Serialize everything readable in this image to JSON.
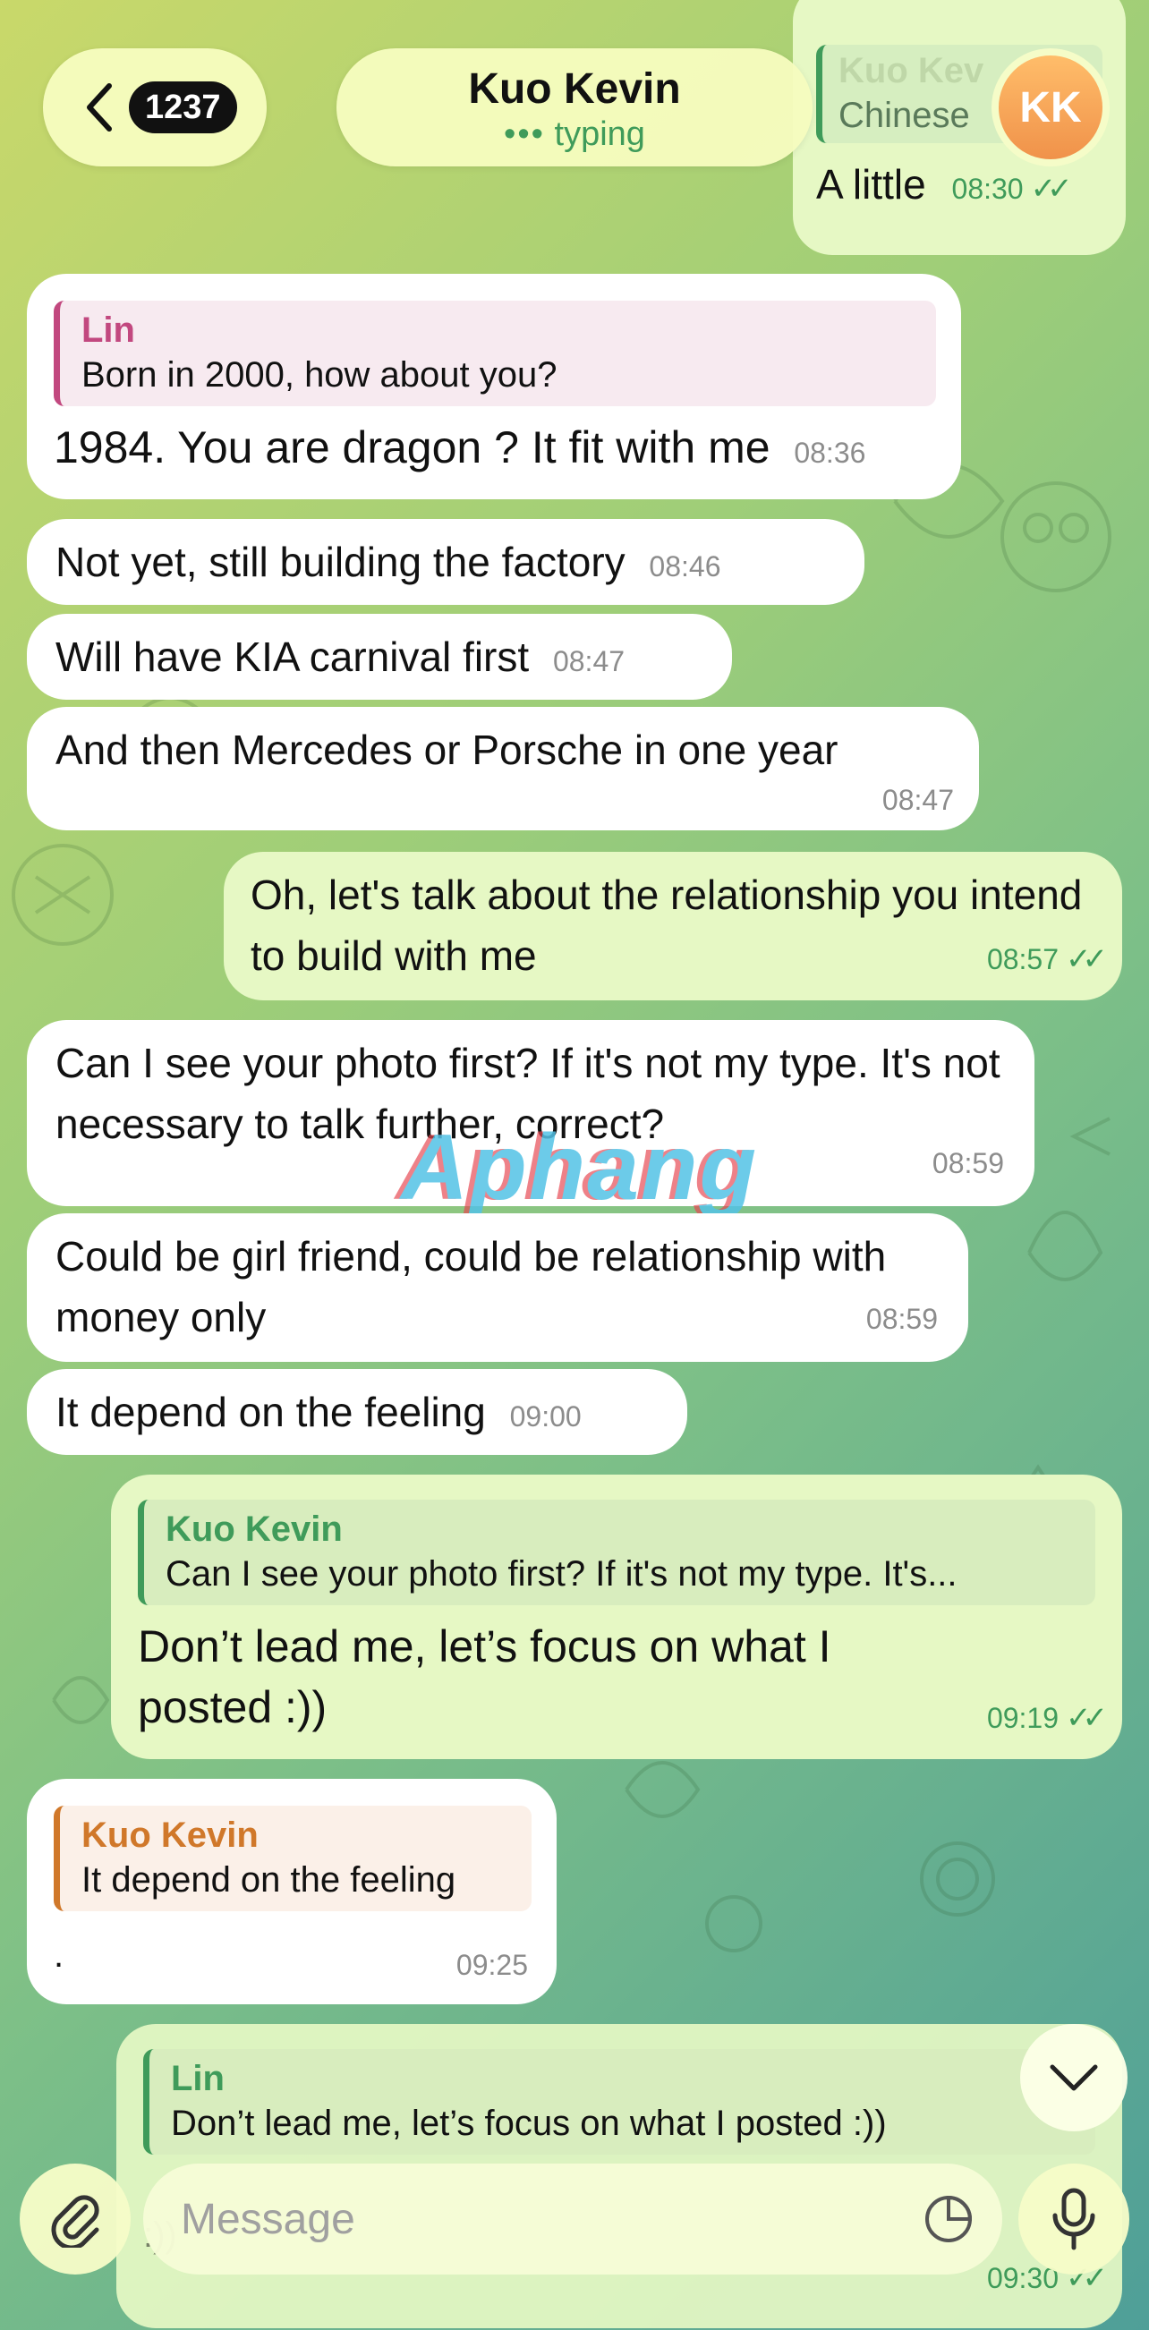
{
  "header": {
    "back_count": "1237",
    "contact_name": "Kuo Kevin",
    "status": "typing",
    "avatar_initials": "KK"
  },
  "top_partial": {
    "reply_name": "Kuo Kev",
    "reply_text": "Chinese",
    "text": "A little",
    "time": "08:30"
  },
  "messages": [
    {
      "reply_name": "Lin",
      "reply_text": "Born in 2000, how about you?",
      "text": "1984.  You are dragon ? It fit with me",
      "time": "08:36"
    },
    {
      "text": "Not yet, still building the factory",
      "time": "08:46"
    },
    {
      "text": "Will have KIA carnival first",
      "time": "08:47"
    },
    {
      "text": "And then Mercedes or Porsche in one year",
      "time": "08:47"
    },
    {
      "text": "Oh, let's talk about the relationship you intend to build with me",
      "time": "08:57"
    },
    {
      "text": "Can I see your photo first? If it's not my type. It's not necessary to talk further, correct?",
      "time": "08:59"
    },
    {
      "text": "Could be girl friend, could be relationship with money only",
      "time": "08:59"
    },
    {
      "text": "It depend on the feeling",
      "time": "09:00"
    },
    {
      "reply_name": "Kuo Kevin",
      "reply_text": "Can I see your photo first? If it's not my type. It's...",
      "text": "Don’t lead me, let’s focus on what I posted :))",
      "time": "09:19"
    },
    {
      "reply_name": "Kuo Kevin",
      "reply_text": "It depend on the feeling",
      "text": ".",
      "time": "09:25"
    },
    {
      "reply_name": "Lin",
      "reply_text": "Don’t lead me, let’s focus on what I posted :))",
      "text": ":))",
      "time": "09:30"
    }
  ],
  "watermark": "Aphang",
  "composer": {
    "placeholder": "Message"
  },
  "colors": {
    "accent_green": "#3f9b5a",
    "reply_pink": "#c2487f",
    "reply_orange": "#d0782a",
    "outgoing_bubble": "#e6f8c4"
  }
}
